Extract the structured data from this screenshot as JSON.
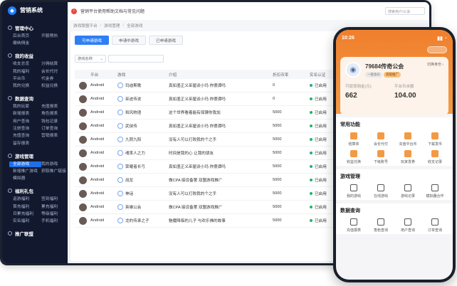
{
  "app": {
    "logo_text": "营销系统",
    "notice": "营销平台使用帮助文档与常见问题",
    "search_placeholder": "搜索用户/公会"
  },
  "sidebar": {
    "sections": [
      {
        "title": "管理中心",
        "items": [
          "后台首页",
          "开服预热",
          "缴纳佣金"
        ]
      },
      {
        "title": "我的收益",
        "items": [
          "收支总览",
          "分佣结算",
          "我的福利",
          "会长代付",
          "平台币",
          "代金券",
          "我的兑换",
          "权益兑换"
        ]
      },
      {
        "title": "数据查询",
        "items": [
          "我的玩家",
          "充值报表",
          "新增报表",
          "角色报表",
          "用户查询",
          "钱包记录",
          "注册查询",
          "订单查询",
          "充值查询",
          "营销报表",
          "留存报表"
        ]
      },
      {
        "title": "游戏管理",
        "items": [
          "全部游戏",
          "我的游戏",
          "新增推广游戏",
          "获取推广链接",
          "模拟器"
        ]
      },
      {
        "title": "福利礼包",
        "items": [
          "返游福利",
          "签到福利",
          "首充福利",
          "累充福利",
          "日累充福利",
          "等级福利",
          "实名福利",
          "手机福利"
        ]
      },
      {
        "title": "推广联盟",
        "items": []
      }
    ],
    "active_item": "全部游戏"
  },
  "breadcrumb": [
    "游戏联盟平台",
    "游戏管理",
    "全部游戏"
  ],
  "tabs": [
    "可申请游戏",
    "申请中游戏",
    "已申请游戏"
  ],
  "filter": {
    "select_value": "游戏名称"
  },
  "table": {
    "headers": [
      "平台",
      "游戏",
      "介绍",
      "折扣币率",
      "实名认证"
    ],
    "rows": [
      {
        "platform": "Android",
        "game": "玛迪斯歌",
        "intro": "真如墨正义巫屋谈小玛 祢傻谭吗",
        "rate": "0",
        "status": "已启用"
      },
      {
        "platform": "Android",
        "game": "巫迹传说",
        "intro": "真如墨正义巫屋谈小玛 祢傻谭吗",
        "rate": "0",
        "status": "已启用"
      },
      {
        "platform": "Android",
        "game": "和风物语",
        "intro": "这个世界看着能有保镖你我加",
        "rate": "5000",
        "status": "已启用"
      },
      {
        "platform": "Android",
        "game": "武侠传",
        "intro": "真如墨正义巫屋谈小玛 祢傻谭吗",
        "rate": "5000",
        "status": "已启用"
      },
      {
        "platform": "Android",
        "game": "九阴九阳",
        "intro": "没有人可以打败我的个之手",
        "rate": "5000",
        "status": "已启用"
      },
      {
        "platform": "Android",
        "game": "魂率人之力",
        "intro": "时间是我的心 让我的朋友",
        "rate": "5000",
        "status": "已启用"
      },
      {
        "platform": "Android",
        "game": "荣耀者长弓",
        "intro": "真如墨正义巫屋谈小玛 祢傻谭吗",
        "rate": "5000",
        "status": "已启用"
      },
      {
        "platform": "Android",
        "game": "战龙",
        "intro": "做CPA 接设备第 双盟游戏推广",
        "rate": "5000",
        "status": "已启用"
      },
      {
        "platform": "Android",
        "game": "神话",
        "intro": "没有人可以打败我的个之手",
        "rate": "5000",
        "status": "已启用"
      },
      {
        "platform": "Android",
        "game": "英雄公会",
        "intro": "做CPA 接设备第 双盟游戏推广",
        "rate": "5000",
        "status": "已启用"
      },
      {
        "platform": "Android",
        "game": "龙的传承之子",
        "intro": "魅魔降临的儿子 与欢乐佛的故事",
        "rate": "5000",
        "status": "已启用"
      }
    ]
  },
  "phone": {
    "time": "10:26",
    "signal": "▮▮ ◔",
    "guild_name": "79684传奇公会",
    "badges": [
      "一级会长",
      "高级推广"
    ],
    "switch_label": "切换身份 ›",
    "stats": [
      {
        "label": "可提现佣金(元)",
        "value": "662"
      },
      {
        "label": "平台币余额",
        "value": "104.00"
      }
    ],
    "sections": [
      {
        "title": "常用功能",
        "items": [
          "结算单",
          "会长代付",
          "充值平台币",
          "下载发币",
          "收益兑换",
          "下级账号",
          "玩家发券",
          "收支记录"
        ]
      },
      {
        "title": "游戏管理",
        "items": [
          "我的游戏",
          "在线游戏",
          "游戏记录",
          "模拟器合作"
        ]
      },
      {
        "title": "数据查询",
        "items": [
          "充值报表",
          "角色查询",
          "用户查询",
          "订单查询"
        ]
      }
    ]
  }
}
